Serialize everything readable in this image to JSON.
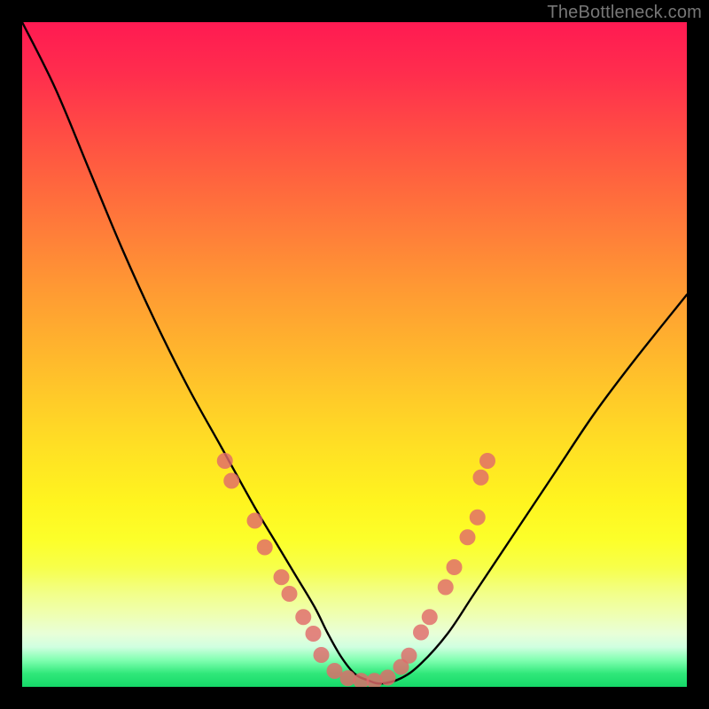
{
  "watermark": "TheBottleneck.com",
  "chart_data": {
    "type": "line",
    "title": "",
    "xlabel": "",
    "ylabel": "",
    "xlim": [
      0,
      100
    ],
    "ylim": [
      0,
      100
    ],
    "gradient_stops": [
      {
        "pos": 0,
        "color": "#ff1a52"
      },
      {
        "pos": 40,
        "color": "#ff9933"
      },
      {
        "pos": 78,
        "color": "#fcff2a"
      },
      {
        "pos": 100,
        "color": "#15d868"
      }
    ],
    "series": [
      {
        "name": "bottleneck-curve",
        "color": "#000000",
        "x": [
          0,
          5,
          10,
          15,
          20,
          25,
          30,
          35,
          38,
          41,
          44,
          46,
          48,
          50,
          52,
          54,
          57,
          60,
          64,
          68,
          74,
          80,
          86,
          92,
          100
        ],
        "y": [
          100,
          90,
          78,
          66,
          55,
          45,
          36,
          27,
          22,
          17,
          12,
          8,
          4.5,
          2,
          1,
          0.5,
          1.3,
          3.5,
          8,
          14,
          23,
          32,
          41,
          49,
          59
        ]
      }
    ],
    "markers": {
      "color": "#e06a6a",
      "radius_px": 9,
      "points": [
        {
          "x": 30.5,
          "y": 34
        },
        {
          "x": 31.5,
          "y": 31
        },
        {
          "x": 35.0,
          "y": 25
        },
        {
          "x": 36.5,
          "y": 21
        },
        {
          "x": 39.0,
          "y": 16.5
        },
        {
          "x": 40.2,
          "y": 14
        },
        {
          "x": 42.3,
          "y": 10.5
        },
        {
          "x": 43.8,
          "y": 8
        },
        {
          "x": 45.0,
          "y": 4.8
        },
        {
          "x": 47.0,
          "y": 2.4
        },
        {
          "x": 49.0,
          "y": 1.3
        },
        {
          "x": 51.0,
          "y": 0.9
        },
        {
          "x": 53.0,
          "y": 0.9
        },
        {
          "x": 55.0,
          "y": 1.4
        },
        {
          "x": 57.0,
          "y": 3.0
        },
        {
          "x": 58.2,
          "y": 4.7
        },
        {
          "x": 60.0,
          "y": 8.2
        },
        {
          "x": 61.3,
          "y": 10.5
        },
        {
          "x": 63.7,
          "y": 15.0
        },
        {
          "x": 65.0,
          "y": 18.0
        },
        {
          "x": 67.0,
          "y": 22.5
        },
        {
          "x": 68.5,
          "y": 25.5
        },
        {
          "x": 69.0,
          "y": 31.5
        },
        {
          "x": 70.0,
          "y": 34.0
        }
      ]
    }
  }
}
